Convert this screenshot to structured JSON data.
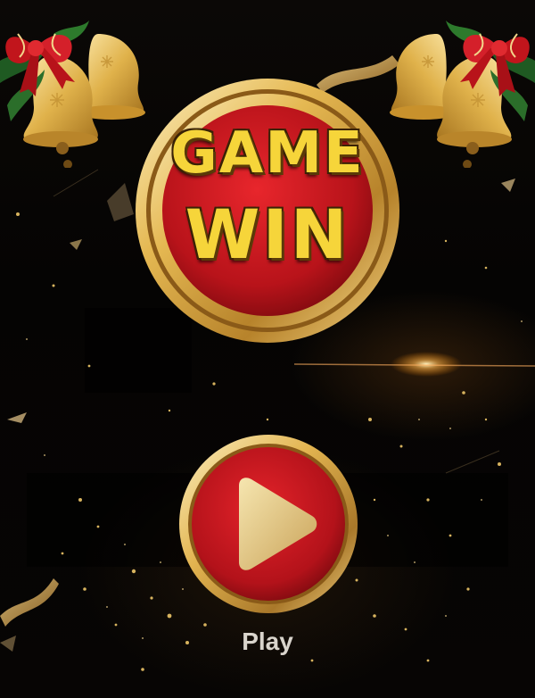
{
  "logo": {
    "line1": "GAME",
    "line2": "WIN"
  },
  "play": {
    "label": "Play",
    "icon": "play-icon"
  },
  "decor": {
    "left_bell": "christmas-bells-icon",
    "right_bell": "christmas-bells-icon"
  },
  "colors": {
    "gold": "#e6b64a",
    "red": "#b8131a",
    "background": "#060403",
    "label": "#d9d4cc"
  }
}
